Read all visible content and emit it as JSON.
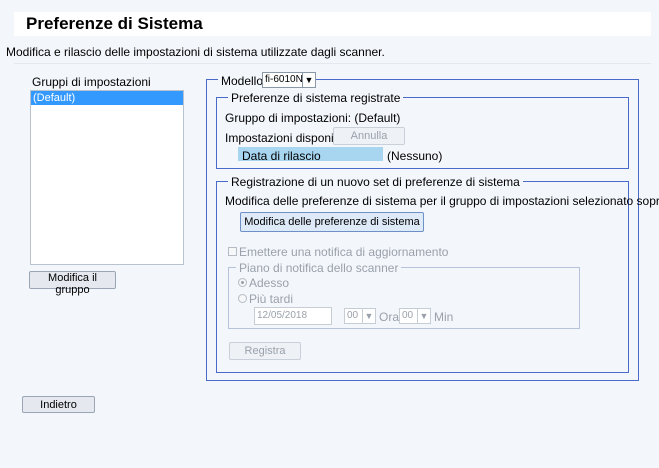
{
  "header": {
    "title": "Preferenze di Sistema"
  },
  "description": "Modifica e rilascio delle impostazioni di sistema utilizzate dagli scanner.",
  "settings_groups": {
    "label": "Gruppi di impostazioni",
    "items": [
      "(Default)"
    ],
    "edit_button": "Modifica il gruppo"
  },
  "model": {
    "label": "Modello:",
    "selected": "fi-6010N"
  },
  "registered": {
    "legend": "Preferenze di sistema registrate",
    "group_text": "Gruppo di impostazioni: (Default)",
    "available_label": "Impostazioni disponibili",
    "cancel_button": "Annulla",
    "release_date_label": "Data di rilascio",
    "release_date_value": "(Nessuno)"
  },
  "new_set": {
    "legend": "Registrazione di un nuovo set di preferenze di sistema",
    "description": "Modifica delle preferenze di sistema per il gruppo di impostazioni selezionato sopra.",
    "edit_button": "Modifica delle preferenze di sistema",
    "notify_checkbox": "Emettere una notifica di aggiornamento",
    "schedule": {
      "legend": "Piano di notifica dello scanner",
      "now": "Adesso",
      "later": "Più tardi",
      "date": "12/05/2018",
      "hour": "00",
      "hour_label": "Ora",
      "minute": "00",
      "minute_label": "Min"
    },
    "register_button": "Registra"
  },
  "footer": {
    "back_button": "Indietro"
  }
}
